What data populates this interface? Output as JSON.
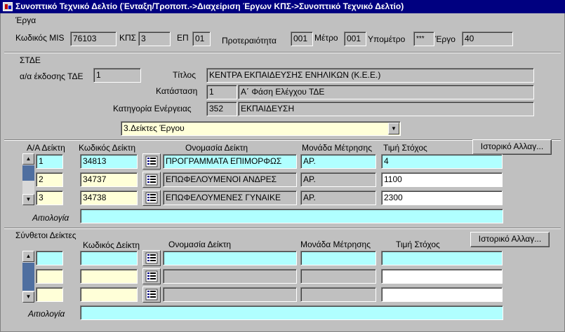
{
  "window": {
    "title": "Συνοπτικό Τεχνικό Δελτίο (Ένταξη/Τροποπ.->Διαχείριση Έργων ΚΠΣ->Συνοπτικό Τεχνικό Δελτίο)"
  },
  "erga": {
    "section_label": "Έργα",
    "mis_label": "Κωδικός MIS",
    "mis_value": "76103",
    "kps_label": "ΚΠΣ",
    "kps_value": "3",
    "ep_label": "ΕΠ",
    "ep_value": "01",
    "priority_label": "Προτεραιότητα",
    "priority_value": "001",
    "metro_label": "Μέτρο",
    "metro_value": "001",
    "submetro_label": "Υπομέτρο",
    "submetro_value": "***",
    "ergo_label": "Έργο",
    "ergo_value": "40"
  },
  "stde": {
    "section_label": "ΣΤΔΕ",
    "issue_label": "α/α έκδοσης ΤΔΕ",
    "issue_value": "1",
    "title_label": "Τίτλος",
    "title_value": "ΚΕΝΤΡΑ ΕΚΠΑΙΔΕΥΣΗΣ ΕΝΗΛΙΚΩΝ (Κ.Ε.Ε.)",
    "status_label": "Κατάσταση",
    "status_code": "1",
    "status_text": "Α΄ Φάση Ελέγχου ΤΔΕ",
    "category_label": "Κατηγορία Ενέργειας",
    "category_code": "352",
    "category_text": "ΕΚΠΑΙΔΕΥΣΗ",
    "tab_selector": "3.Δείκτες Έργου"
  },
  "indicators": {
    "col_aa": "Α/Α Δείκτη",
    "col_code": "Κωδικός Δείκτη",
    "col_name": "Ονομασία Δείκτη",
    "col_unit": "Μονάδα Μέτρησης",
    "col_target": "Τιμή Στόχος",
    "history_button": "Ιστορικό Αλλαγ...",
    "justification_label": "Αιτιολογία",
    "rows": [
      {
        "aa": "1",
        "code": "34813",
        "name": "ΠΡΟΓΡΑΜΜΑΤΑ  ΕΠΙΜΟΡΦΩΣ",
        "unit": "ΑΡ.",
        "target": "4"
      },
      {
        "aa": "2",
        "code": "34737",
        "name": "ΕΠΩΦΕΛΟΥΜΕΝΟΙ ΑΝΔΡΕΣ",
        "unit": "ΑΡ.",
        "target": "1100"
      },
      {
        "aa": "3",
        "code": "34738",
        "name": "ΕΠΩΦΕΛΟΥΜΕΝΕΣ ΓΥΝΑΙΚΕ",
        "unit": "ΑΡ.",
        "target": "2300"
      }
    ]
  },
  "composite": {
    "section_label": "Σύνθετοι Δείκτες",
    "col_code": "Κωδικός Δείκτη",
    "col_name": "Ονομασία Δείκτη",
    "col_unit": "Μονάδα Μέτρησης",
    "col_target": "Τιμή Στόχος",
    "history_button": "Ιστορικό Αλλαγ...",
    "justification_label": "Αιτιολογία"
  },
  "icons": {
    "scroll_up": "▲",
    "scroll_down": "▼",
    "combo_arrow": "▼"
  }
}
